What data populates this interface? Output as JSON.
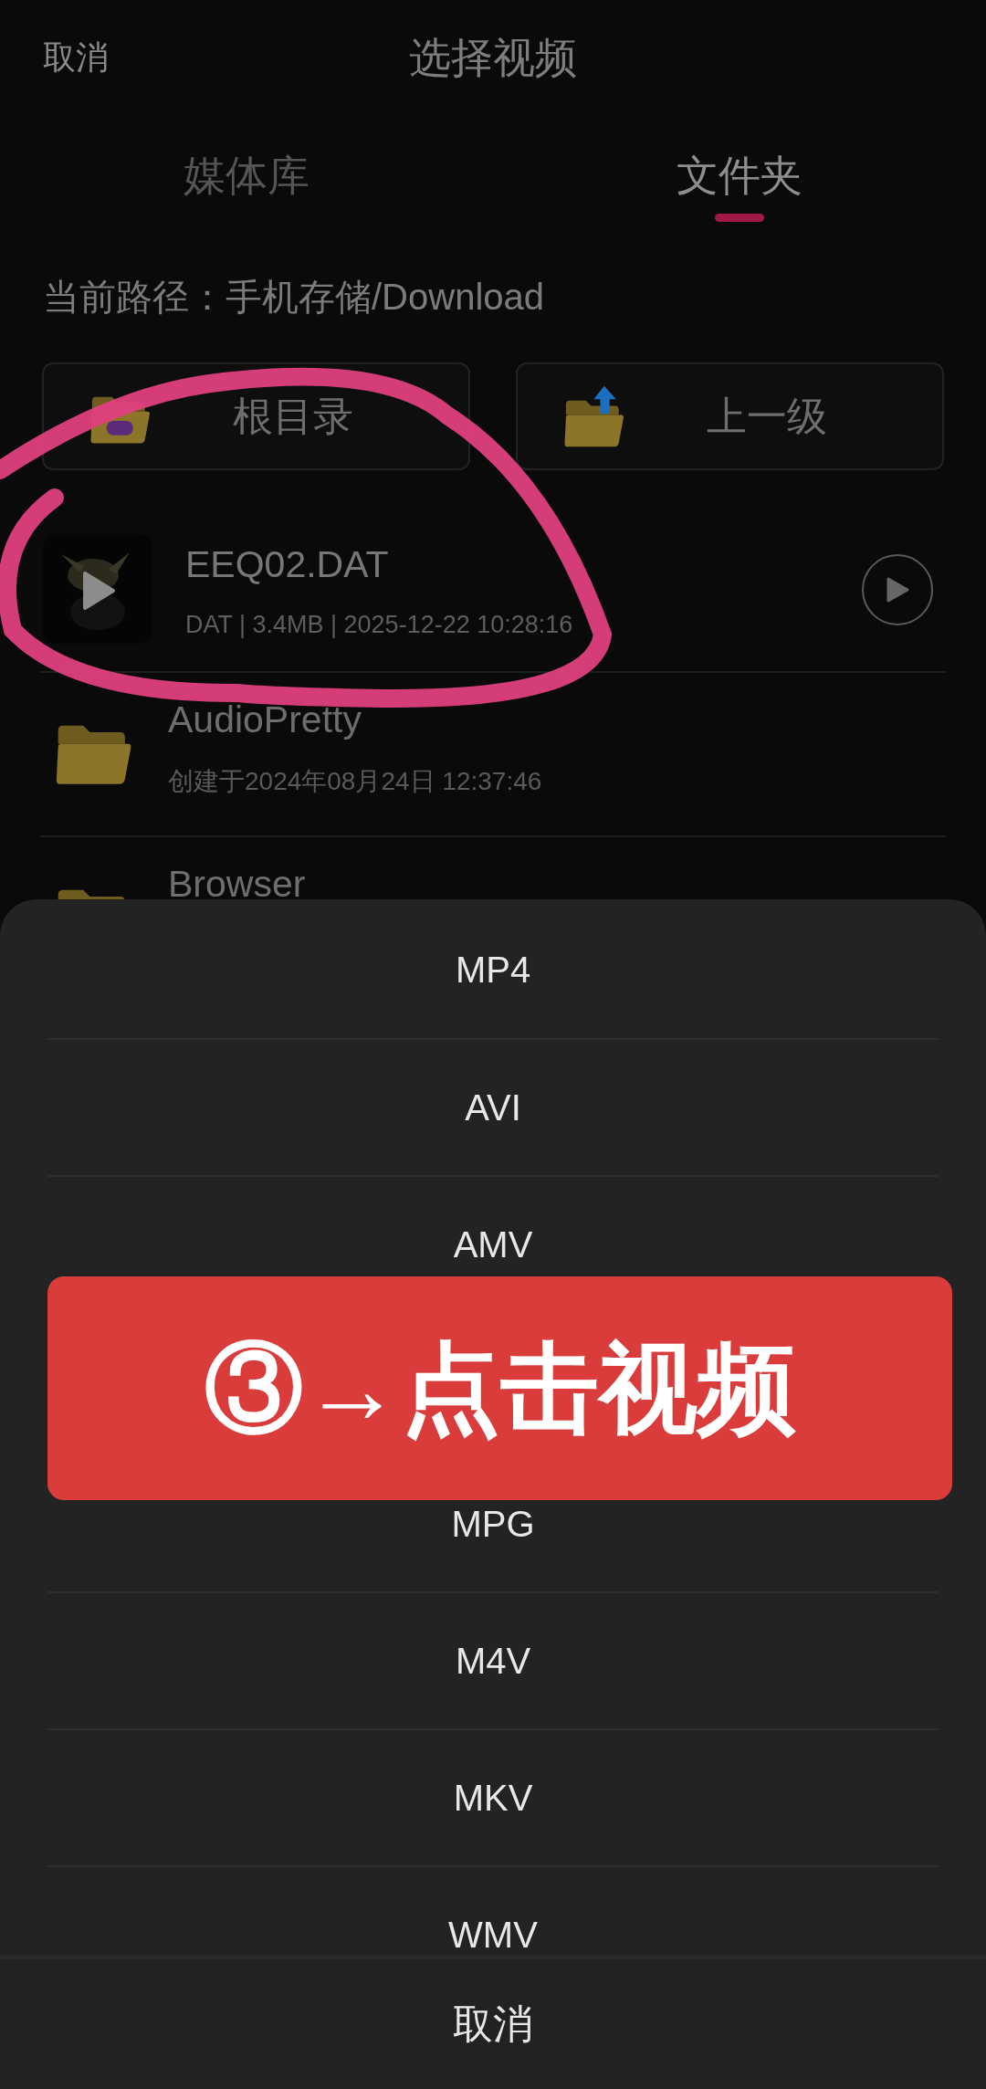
{
  "header": {
    "cancel": "取消",
    "title": "选择视频"
  },
  "tabs": [
    {
      "label": "媒体库",
      "selected": false
    },
    {
      "label": "文件夹",
      "selected": true
    }
  ],
  "path": "当前路径：手机存储/Download",
  "nav_buttons": [
    {
      "kind": "root",
      "label": "根目录"
    },
    {
      "kind": "up",
      "label": "上一级"
    }
  ],
  "files": [
    {
      "kind": "video",
      "name": "EEQ02.DAT",
      "meta": "DAT | 3.4MB | 2025-12-22 10:28:16"
    },
    {
      "kind": "folder",
      "name": "AudioPretty",
      "meta": "创建于2024年08月24日 12:37:46"
    },
    {
      "kind": "folder",
      "name": "Browser"
    }
  ],
  "format_sheet": {
    "options_above": [
      "MP4",
      "AVI",
      "AMV"
    ],
    "options_below": [
      "MPG",
      "M4V",
      "MKV",
      "WMV"
    ],
    "cancel": "取消"
  },
  "overlay_banner": "③→点击视频"
}
